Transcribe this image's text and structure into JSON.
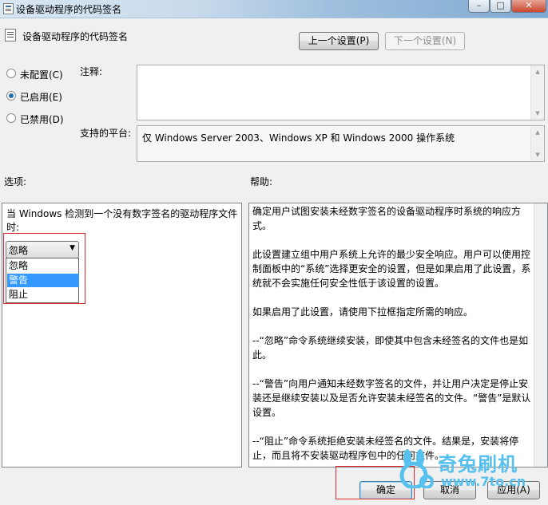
{
  "window": {
    "title": "设备驱动程序的代码签名",
    "minimize_glyph": "–",
    "maximize_glyph": "□",
    "close_glyph": "✕"
  },
  "header": {
    "title": "设备驱动程序的代码签名",
    "prev_button": "上一个设置(P)",
    "next_button": "下一个设置(N)"
  },
  "state_options": {
    "not_configured": "未配置(C)",
    "enabled": "已启用(E)",
    "disabled": "已禁用(D)",
    "selected": "enabled"
  },
  "comment": {
    "label": "注释:",
    "value": ""
  },
  "platform": {
    "label": "支持的平台:",
    "value": "仅 Windows Server 2003、Windows XP 和 Windows 2000 操作系统"
  },
  "options": {
    "label": "选项:",
    "description": "当 Windows 检测到一个没有数字签名的驱动程序文件时:",
    "combo_value": "忽略",
    "dropdown_items": [
      "忽略",
      "警告",
      "阻止"
    ],
    "highlighted_item": "警告"
  },
  "help": {
    "label": "帮助:",
    "paragraphs": [
      "确定用户试图安装未经数字签名的设备驱动程序时系统的响应方式。",
      "此设置建立组中用户系统上允许的最少安全响应。用户可以使用控制面板中的“系统”选择更安全的设置，但是如果启用了此设置，系统就不会实施任何安全性低于该设置的设置。",
      "如果启用了此设置，请使用下拉框指定所需的响应。",
      "--“忽略”命令系统继续安装，即使其中包含未经签名的文件也是如此。",
      "--“警告”向用户通知未经数字签名的文件，并让用户决定是停止安装还是继续安装以及是否允许安装未经签名的文件。“警告”是默认设置。",
      "--“阻止”命令系统拒绝安装未经签名的文件。结果是，安装将停止，而且将不安装驱动程序包中的任何文件。"
    ]
  },
  "footer": {
    "ok": "确定",
    "cancel": "取消",
    "apply": "应用(A)"
  },
  "watermark": {
    "name": "奇兔刷机",
    "url": "www.7to.cn"
  },
  "colors": {
    "highlight": "#3399ff",
    "annotation_red": "#e0282a",
    "watermark": "#56c0ee"
  }
}
